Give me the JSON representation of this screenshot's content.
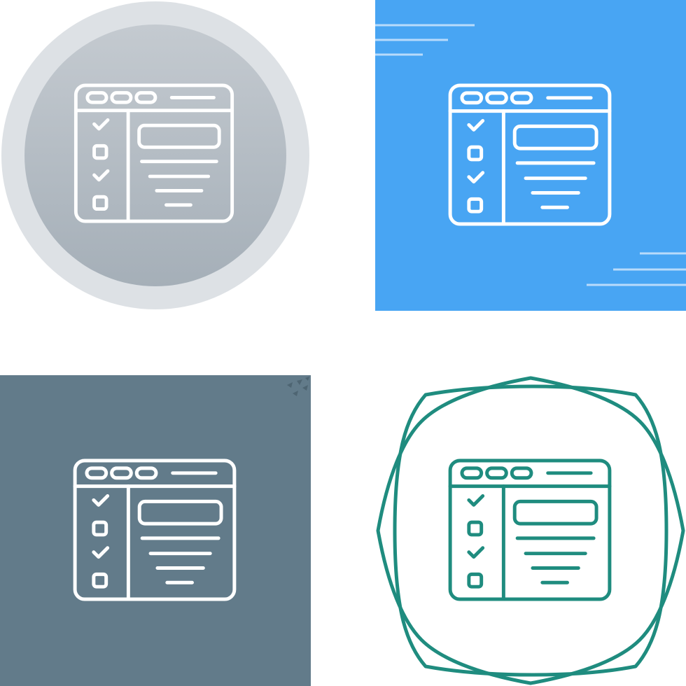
{
  "variants": [
    {
      "id": "gray-circle-badge",
      "icon": "checklist-window-icon",
      "background": "circle",
      "colors": {
        "outer": "#dde1e5",
        "inner_top": "#c4cad0",
        "inner_bottom": "#a5afb8",
        "stroke": "#ffffff"
      }
    },
    {
      "id": "blue-square-badge",
      "icon": "checklist-window-icon",
      "background": "square",
      "colors": {
        "fill": "#48a5f3",
        "accent_lines": "#b8dbfb",
        "stroke": "#ffffff"
      }
    },
    {
      "id": "slate-square-badge",
      "icon": "checklist-window-icon",
      "background": "square",
      "colors": {
        "fill": "#627b8a",
        "stroke": "#ffffff"
      }
    },
    {
      "id": "teal-outline-badge",
      "icon": "checklist-window-icon",
      "background": "octagon-outline",
      "colors": {
        "stroke": "#1f8c7f"
      }
    }
  ]
}
